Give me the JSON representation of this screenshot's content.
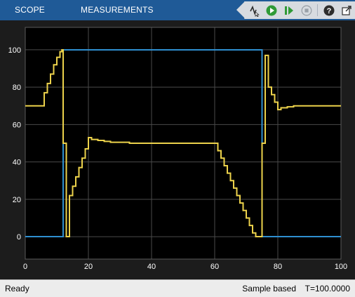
{
  "toolstrip": {
    "tabs": [
      {
        "label": "SCOPE"
      },
      {
        "label": "MEASUREMENTS"
      }
    ],
    "buttons": [
      {
        "name": "signal-selection",
        "icon": "signal-select-icon"
      },
      {
        "name": "run",
        "icon": "run-icon"
      },
      {
        "name": "step-forward",
        "icon": "step-forward-icon"
      },
      {
        "name": "stop",
        "icon": "stop-icon"
      },
      {
        "name": "help",
        "icon": "help-icon"
      },
      {
        "name": "undock",
        "icon": "undock-icon"
      }
    ]
  },
  "status": {
    "state": "Ready",
    "mode": "Sample based",
    "time": "T=100.0000"
  },
  "chart_data": {
    "type": "line",
    "title": "",
    "xlabel": "",
    "ylabel": "",
    "xlim": [
      0,
      100
    ],
    "ylim": [
      -12,
      112
    ],
    "xticks": [
      0,
      20,
      40,
      60,
      80,
      100
    ],
    "yticks": [
      0,
      20,
      40,
      60,
      80,
      100
    ],
    "grid": true,
    "background": "#1c1c1c",
    "axes_color": "#000000",
    "grid_color": "#4a4a4a",
    "series": [
      {
        "color": "#2f8fd0",
        "step": true,
        "points": [
          [
            0,
            0
          ],
          [
            12,
            0
          ],
          [
            12,
            100
          ],
          [
            75,
            100
          ],
          [
            75,
            0
          ],
          [
            100,
            0
          ]
        ]
      },
      {
        "color": "#ecd24b",
        "step": true,
        "points": [
          [
            0,
            70
          ],
          [
            6,
            70
          ],
          [
            6,
            77
          ],
          [
            7,
            77
          ],
          [
            7,
            82
          ],
          [
            8,
            82
          ],
          [
            8,
            87
          ],
          [
            9,
            87
          ],
          [
            9,
            92
          ],
          [
            10,
            92
          ],
          [
            10,
            96
          ],
          [
            11,
            96
          ],
          [
            11,
            99
          ],
          [
            11.6,
            99
          ],
          [
            11.6,
            100
          ],
          [
            12,
            100
          ],
          [
            12,
            50
          ],
          [
            13,
            50
          ],
          [
            13,
            0
          ],
          [
            14,
            0
          ],
          [
            14,
            22
          ],
          [
            15,
            22
          ],
          [
            15,
            27
          ],
          [
            16,
            27
          ],
          [
            16,
            32
          ],
          [
            17,
            32
          ],
          [
            17,
            37
          ],
          [
            18,
            37
          ],
          [
            18,
            42
          ],
          [
            19,
            42
          ],
          [
            19,
            47
          ],
          [
            20,
            47
          ],
          [
            20,
            53
          ],
          [
            21,
            53
          ],
          [
            21,
            52
          ],
          [
            23,
            52
          ],
          [
            23,
            51.5
          ],
          [
            25,
            51.5
          ],
          [
            25,
            51
          ],
          [
            27,
            51
          ],
          [
            27,
            50.5
          ],
          [
            33,
            50.5
          ],
          [
            33,
            50
          ],
          [
            60,
            50
          ],
          [
            61,
            50
          ],
          [
            61,
            46
          ],
          [
            62,
            46
          ],
          [
            62,
            42
          ],
          [
            63,
            42
          ],
          [
            63,
            38
          ],
          [
            64,
            38
          ],
          [
            64,
            34
          ],
          [
            65,
            34
          ],
          [
            65,
            30
          ],
          [
            66,
            30
          ],
          [
            66,
            26
          ],
          [
            67,
            26
          ],
          [
            67,
            22
          ],
          [
            68,
            22
          ],
          [
            68,
            18
          ],
          [
            69,
            18
          ],
          [
            69,
            14
          ],
          [
            70,
            14
          ],
          [
            70,
            10
          ],
          [
            71,
            10
          ],
          [
            71,
            6
          ],
          [
            72,
            6
          ],
          [
            72,
            2
          ],
          [
            73,
            2
          ],
          [
            73,
            0
          ],
          [
            75,
            0
          ],
          [
            75,
            50
          ],
          [
            76,
            50
          ],
          [
            76,
            97
          ],
          [
            77,
            97
          ],
          [
            77,
            80
          ],
          [
            78,
            80
          ],
          [
            78,
            76
          ],
          [
            79,
            76
          ],
          [
            79,
            72
          ],
          [
            80,
            72
          ],
          [
            80,
            68
          ],
          [
            81,
            68
          ],
          [
            81,
            69
          ],
          [
            83,
            69
          ],
          [
            83,
            69.5
          ],
          [
            85,
            69.5
          ],
          [
            85,
            70
          ],
          [
            100,
            70
          ]
        ]
      }
    ]
  }
}
